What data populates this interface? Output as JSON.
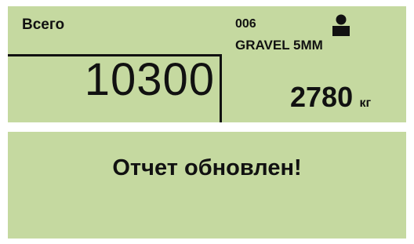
{
  "scale": {
    "total_label": "Всего",
    "total_value": "10300",
    "code": "006",
    "material": "GRAVEL 5ММ",
    "weight_value": "2780",
    "weight_unit": "кг",
    "icon": "person-icon"
  },
  "notification": {
    "message": "Отчет обновлен!"
  },
  "colors": {
    "panel_background": "#c5d9a0",
    "text": "#111111"
  }
}
